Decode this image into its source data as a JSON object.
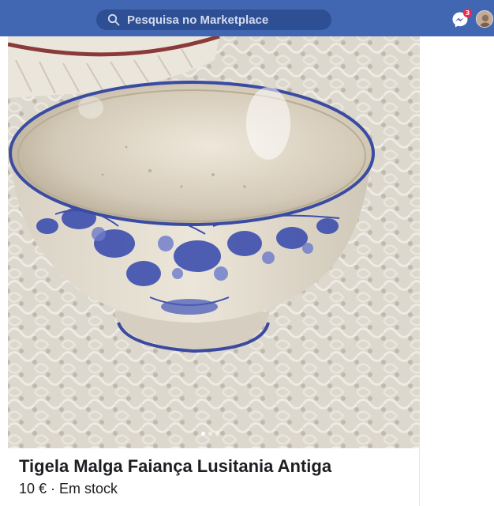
{
  "header": {
    "search": {
      "placeholder": "Pesquisa no Marketplace",
      "icon": "search-icon"
    },
    "messenger": {
      "icon": "messenger-icon",
      "badge_count": "3",
      "badge_color": "#f02849"
    },
    "avatar": {
      "icon": "avatar"
    },
    "bar_color": "#4267b2"
  },
  "listing": {
    "title": "Tigela Malga Faiança Lusitania Antiga",
    "price": "10 €",
    "separator": " · ",
    "status": "Em stock",
    "photo": {
      "count": 3,
      "active_index": 0
    }
  }
}
